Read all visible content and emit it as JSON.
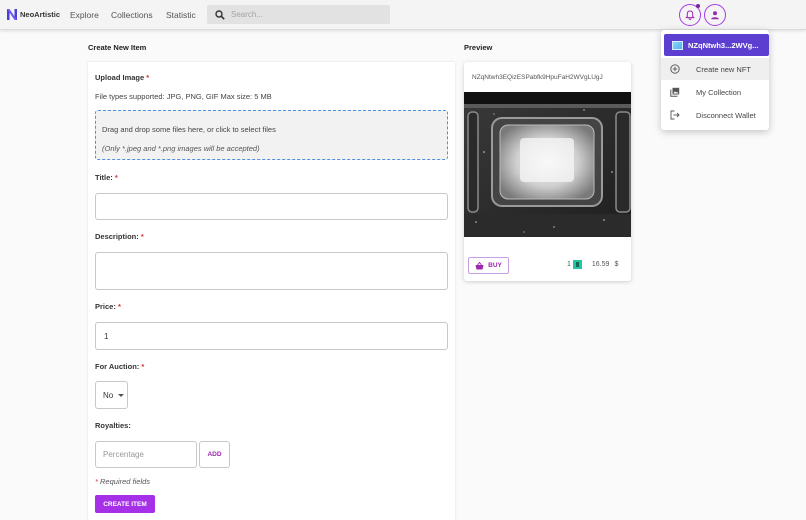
{
  "navbar": {
    "logo_text": "NeoArtistic",
    "links": [
      "Explore",
      "Collections",
      "Statistic"
    ],
    "search_placeholder": "Search..."
  },
  "account_menu": {
    "wallet_short": "NZqNtwh3...2WVg...",
    "items": [
      "Create new NFT",
      "My Collection",
      "Disconnect Wallet"
    ],
    "active_item": "Create new NFT"
  },
  "form": {
    "heading": "Create New Item",
    "upload_label": "Upload Image",
    "upload_hint": "File types supported: JPG, PNG, GIF Max size: 5 MB",
    "dropzone_text": "Drag and drop some files here, or click to select files",
    "dropzone_note": "(Only *.jpeg and *.png images will be accepted)",
    "title_label": "Title:",
    "title_value": "",
    "description_label": "Description:",
    "description_value": "",
    "price_label": "Price:",
    "price_value": "1",
    "auction_label": "For Auction:",
    "auction_value": "No",
    "royalties_label": "Royalties:",
    "royalties_placeholder": "Percentage",
    "add_label": "ADD",
    "required_note": "Required fields",
    "required_mark": "*",
    "submit_label": "CREATE ITEM"
  },
  "preview": {
    "heading": "Preview",
    "address": "NZqNtwh3EQizESPabfk9HpuFaH2WVgLUgJ",
    "buy_label": "BUY",
    "quantity": "1",
    "price": "16.59",
    "currency_symbol": "$"
  },
  "colors": {
    "accent": "#a630e8",
    "menu_header": "#5c3fd1",
    "dropzone_border": "#4f8fe0",
    "required": "#d32f2f"
  }
}
